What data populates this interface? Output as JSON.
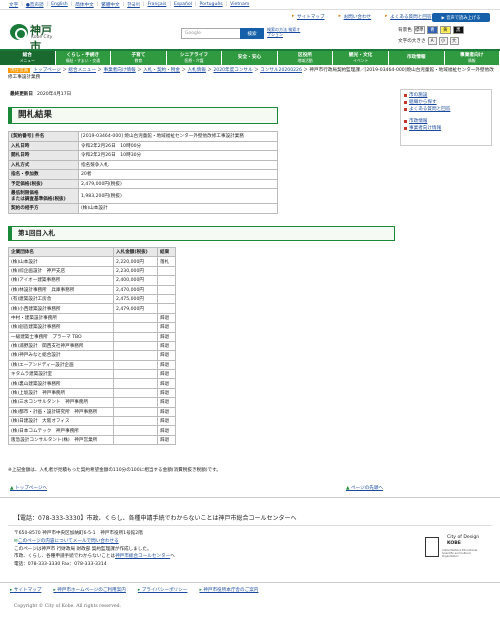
{
  "langbar": {
    "items": [
      "文字",
      "●音声読",
      "English",
      "简体中文",
      "繁體中文",
      "한국어",
      "Français",
      "Español",
      "Português",
      "Vietnam"
    ]
  },
  "header": {
    "logo_name": "神戸市",
    "logo_en": "Kobe City",
    "links": [
      "サイトマップ",
      "お問い合わせ",
      "よくある質問と回答"
    ],
    "voice_button": "▶ 音声で読み上げる",
    "search_placeholder": "Google",
    "search_button": "検索",
    "search_option": "検索の方法 検索オプション",
    "bgcolor_label": "背景色",
    "bgcolor_options": [
      "標準",
      "青",
      "黄",
      "黒"
    ],
    "textsize_label": "文字の大きさ",
    "textsize_options": [
      "A",
      "小",
      "大"
    ]
  },
  "nav": [
    {
      "label": "総合",
      "sub": "メニュー"
    },
    {
      "label": "くらし・手続き",
      "sub": "福祉・すまい・交通"
    },
    {
      "label": "子育て",
      "sub": "教育"
    },
    {
      "label": "シニアライフ",
      "sub": "医療・介護"
    },
    {
      "label": "安全・安心",
      "sub": ""
    },
    {
      "label": "区役所",
      "sub": "地域活動"
    },
    {
      "label": "観光・文化",
      "sub": "イベント"
    },
    {
      "label": "市政情報",
      "sub": ""
    },
    {
      "label": "事業者向け",
      "sub": "情報"
    }
  ],
  "breadcrumb": {
    "current_label": "現在位置",
    "items": [
      "トップページ",
      "総合メニュー",
      "事業者向け情報",
      "入札・契約・税金",
      "入札情報",
      "2020年度コンサル",
      "コンサル20200226"
    ],
    "tail": "神戸市行政局契約監理課／[2019-03464-000]焼山台児童館・地域福祉センター外壁他改修工事設計業務"
  },
  "updated": {
    "label": "最終更新日",
    "date": "2020年4月17日"
  },
  "title": "開札結果",
  "info_rows": [
    {
      "k": "[契約番号] 件名",
      "v": "[2019-03464-000] 焼山台児童館・地域福祉センター外壁他改修工事設計業務"
    },
    {
      "k": "入札日時",
      "v": "令和2年2月26日　10時00分"
    },
    {
      "k": "開札日時",
      "v": "令和2年2月26日　10時30分"
    },
    {
      "k": "入札方式",
      "v": "指名競争入札"
    },
    {
      "k": "指名・参加数",
      "v": "20者"
    },
    {
      "k": "予定価格(税抜)",
      "v": "2,479,000円(税抜)"
    },
    {
      "k": "最低制限価格\nまたは調査基準価格(税抜)",
      "v": "1,983,200円(税抜)"
    },
    {
      "k": "契約の相手方",
      "v": "(株)山本設計"
    }
  ],
  "sidebar": [
    "市の施設",
    "組織から探す",
    "よくある質問と回答",
    "",
    "市政情報",
    "事業者向け情報"
  ],
  "round_title": "第1回目入札",
  "bid_header": [
    "企業団体名",
    "入札金額(税抜)",
    "結果"
  ],
  "bids": [
    [
      "(株)山本設計",
      "2,220,000円",
      "落札"
    ],
    [
      "(株)綜企画設計　神戸支店",
      "2,230,000円",
      ""
    ],
    [
      "(株)アイオー建築事務所",
      "2,400,000円",
      ""
    ],
    [
      "(株)林設計事務所　兵庫事務所",
      "2,470,000円",
      ""
    ],
    [
      "(有)建築設計工房舎",
      "2,475,000円",
      ""
    ],
    [
      "(株)小西建築設計事務所",
      "2,479,000円",
      ""
    ],
    [
      "中村・建築設計事務所",
      "",
      "辞退"
    ],
    [
      "(株)創造建築設計事務所",
      "",
      "辞退"
    ],
    [
      "一級建築士事務所　プラーマ TBO",
      "",
      "辞退"
    ],
    [
      "(株)浦野設計　関西支社神戸事務所",
      "",
      "辞退"
    ],
    [
      "(株)神戸みなと総合設計",
      "",
      "辞退"
    ],
    [
      "(株)エーアンドディー設計企画",
      "",
      "辞退"
    ],
    [
      "キタムラ建築設計室",
      "",
      "辞退"
    ],
    [
      "(株)裏山建築設計事務所",
      "",
      "辞退"
    ],
    [
      "(株)上坂設計　神戸事務所",
      "",
      "辞退"
    ],
    [
      "(株)三水コンサルタント　神戸事務所",
      "",
      "辞退"
    ],
    [
      "(株)都市・計画・設計研究所　神戸事務所",
      "",
      "辞退"
    ],
    [
      "(株)日建設計　大阪オフィス",
      "",
      "辞退"
    ],
    [
      "(株)日本コムテック　神戸事務所",
      "",
      "辞退"
    ],
    [
      "阪急設計コンサルタント(株)　神戸営業所",
      "",
      "辞退"
    ]
  ],
  "note": "※上記金額は、入札者が見積もった契約希望金額の110分の100に相当する金額(消費税抜き税額)です。",
  "to_top": "トップページへ",
  "to_page_top": "ページの先頭へ",
  "call_center": "【電話：078-333-3330】市政、くらし、各種申請手続でわからないことは神戸市総合コールセンターへ",
  "address": {
    "line1": "〒650-8570 神戸市中央区加納町6-5-1　神戸市役所1号館2階",
    "line2_link": "このページの内容についてメールで問い合わせる",
    "line3": "このページは神戸市 行財政局 財政部 契約監理課が作成しました。",
    "line4_pre": "市政、くらし、各種申請手続でわからないことは",
    "line4_link": "神戸市総合コールセンター",
    "line4_post": "へ",
    "line5": "電話：078-333-3330 Fax：078-333-3314"
  },
  "unesco": {
    "city": "City of Design",
    "name": "KOBE",
    "desc": "United Nations Educational, Scientific and Cultural Organization"
  },
  "footer_links": [
    "サイトマップ",
    "神戸市ホームページのご利用案内",
    "プライバシーポリシー",
    "神戸市役所本庁舎のご案内"
  ],
  "copyright": "Copyright © City of Kobe. All rights reserved."
}
